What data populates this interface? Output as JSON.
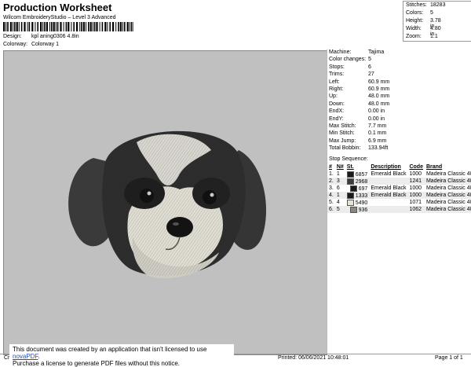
{
  "header": {
    "title": "Production Worksheet",
    "subtitle": "Wilcom EmbroideryStudio – Level 3 Advanced",
    "design_label": "Design:",
    "design_value": "kpl aning0306 4.8in",
    "colorway_label": "Colorway:",
    "colorway_value": "Colorway 1"
  },
  "summary": [
    {
      "label": "Stitches:",
      "value": "18283"
    },
    {
      "label": "Colors:",
      "value": "5"
    },
    {
      "label": "Height:",
      "value": "3.78 in"
    },
    {
      "label": "Width:",
      "value": "4.80 in"
    },
    {
      "label": "Zoom:",
      "value": "1:1"
    }
  ],
  "params": [
    {
      "label": "Machine:",
      "value": "Tajima"
    },
    {
      "label": "Color changes:",
      "value": "5"
    },
    {
      "label": "Stops:",
      "value": "6"
    },
    {
      "label": "Trims:",
      "value": "27"
    },
    {
      "label": "Left:",
      "value": "60.9 mm"
    },
    {
      "label": "Right:",
      "value": "60.9 mm"
    },
    {
      "label": "Up:",
      "value": "48.0 mm"
    },
    {
      "label": "Down:",
      "value": "48.0 mm"
    },
    {
      "label": "EndX:",
      "value": "0.00 in"
    },
    {
      "label": "EndY:",
      "value": "0.00 in"
    },
    {
      "label": "Max Stitch:",
      "value": "7.7 mm"
    },
    {
      "label": "Min Stitch:",
      "value": "0.1 mm"
    },
    {
      "label": "Max Jump:",
      "value": "6.9 mm"
    },
    {
      "label": "Total Bobbin:",
      "value": "133.94ft"
    }
  ],
  "stop_sequence": {
    "label": "Stop Sequence:",
    "headers": [
      "#",
      "N#",
      "St.",
      "Description",
      "Code",
      "Brand"
    ],
    "rows": [
      {
        "num": "1.",
        "n": "1",
        "color": "#1a1a1a",
        "st": "6857",
        "desc": "Emerald Black",
        "code": "1000",
        "brand": "Madeira Classic 40"
      },
      {
        "num": "2.",
        "n": "3",
        "color": "#3c3c3c",
        "st": "2968",
        "desc": "",
        "code": "1241",
        "brand": "Madeira Classic 40"
      },
      {
        "num": "3.",
        "n": "6",
        "color": "#1a1a1a",
        "st": "697",
        "desc": "Emerald Black",
        "code": "1000",
        "brand": "Madeira Classic 40"
      },
      {
        "num": "4.",
        "n": "1",
        "color": "#1a1a1a",
        "st": "1333",
        "desc": "Emerald Black",
        "code": "1000",
        "brand": "Madeira Classic 40"
      },
      {
        "num": "5.",
        "n": "4",
        "color": "#e8e2d4",
        "st": "5490",
        "desc": "",
        "code": "1071",
        "brand": "Madeira Classic 40"
      },
      {
        "num": "6.",
        "n": "5",
        "color": "#8a8680",
        "st": "936",
        "desc": "",
        "code": "1062",
        "brand": "Madeira Classic 40"
      }
    ]
  },
  "footer": {
    "cr": "Cr",
    "printed": "Printed: 06/06/2021 10:48:01",
    "page": "Page 1 of 1"
  },
  "notice": {
    "line1_pre": "This document was created by an application that isn't licensed to use ",
    "link": "novaPDF",
    "line1_post": ".",
    "line2": "Purchase a license to generate PDF files without this notice."
  }
}
